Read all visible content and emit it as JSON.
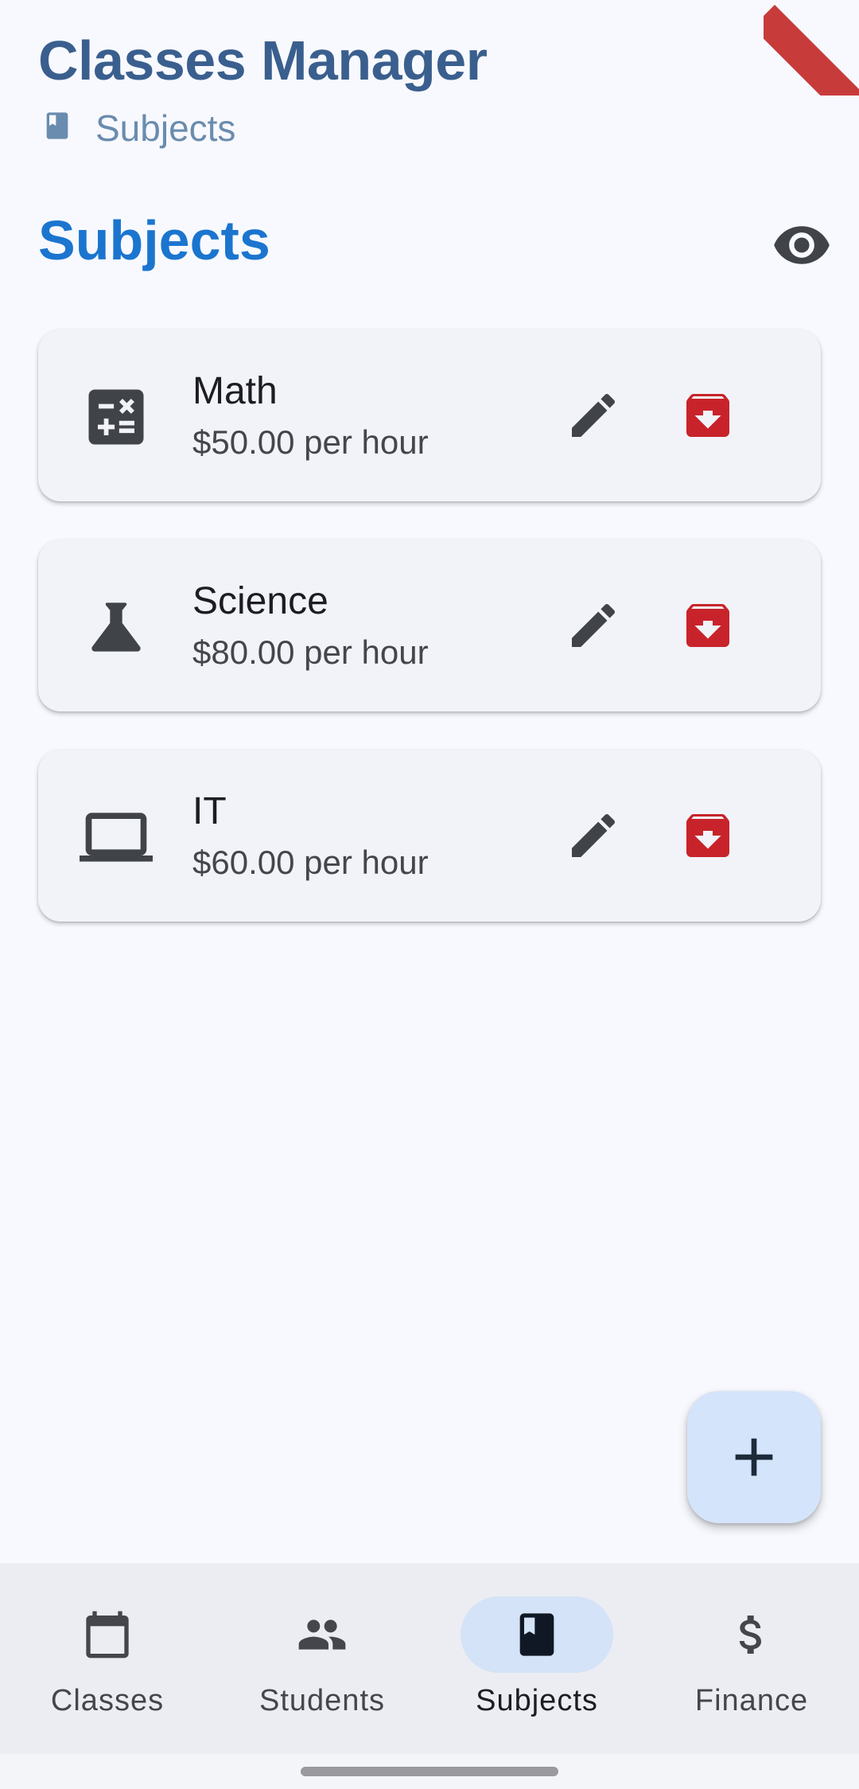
{
  "app": {
    "title": "Classes Manager",
    "breadcrumb": "Subjects",
    "breadcrumb_icon": "book-icon"
  },
  "section": {
    "title": "Subjects",
    "toggle_icon": "eye-icon"
  },
  "subjects": [
    {
      "name": "Math",
      "rate": "$50.00 per hour",
      "icon": "calculate-icon"
    },
    {
      "name": "Science",
      "rate": "$80.00 per hour",
      "icon": "flask-icon"
    },
    {
      "name": "IT",
      "rate": "$60.00 per hour",
      "icon": "laptop-icon"
    }
  ],
  "fab_icon": "plus-icon",
  "nav": [
    {
      "label": "Classes",
      "icon": "calendar-icon",
      "active": false
    },
    {
      "label": "Students",
      "icon": "people-icon",
      "active": false
    },
    {
      "label": "Subjects",
      "icon": "book-icon",
      "active": true
    },
    {
      "label": "Finance",
      "icon": "dollar-icon",
      "active": false
    }
  ],
  "colors": {
    "background": "#f8f9fe",
    "app_title": "#3a5f8e",
    "section_title": "#1b75cf",
    "delete_red": "#c8232a",
    "fab_background": "#d4e4fa",
    "nav_active_pill": "#d4e3f7"
  }
}
